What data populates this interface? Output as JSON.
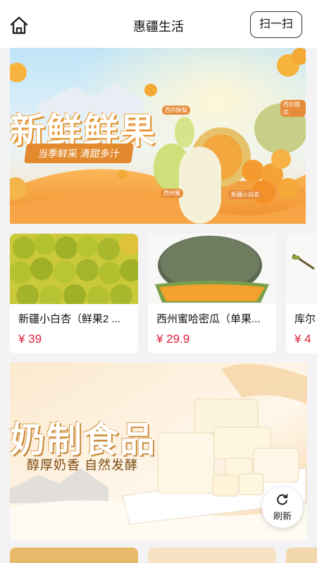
{
  "header": {
    "title": "惠疆生活",
    "scan_label": "扫一扫",
    "home_icon": "home-icon"
  },
  "banner1": {
    "title": "新鲜鲜果",
    "subtitle": "当季鲜采 清甜多汁",
    "tags": [
      "西尔酥梨",
      "西尔甜瓜",
      "西州蜜",
      "新疆小白杏"
    ]
  },
  "products": [
    {
      "name": "新疆小白杏（鲜果2 ...",
      "price": "¥ 39"
    },
    {
      "name": "西州蜜哈密瓜（单果...",
      "price": "¥ 29.9"
    },
    {
      "name": "库尔",
      "price": "¥ 4"
    }
  ],
  "banner2": {
    "title": "奶制食品",
    "subtitle": "醇厚奶香 自然发酵"
  },
  "refresh": {
    "label": "刷新",
    "icon": "refresh-icon"
  },
  "colors": {
    "price": "#e0203a",
    "accent": "#e38a2f"
  }
}
